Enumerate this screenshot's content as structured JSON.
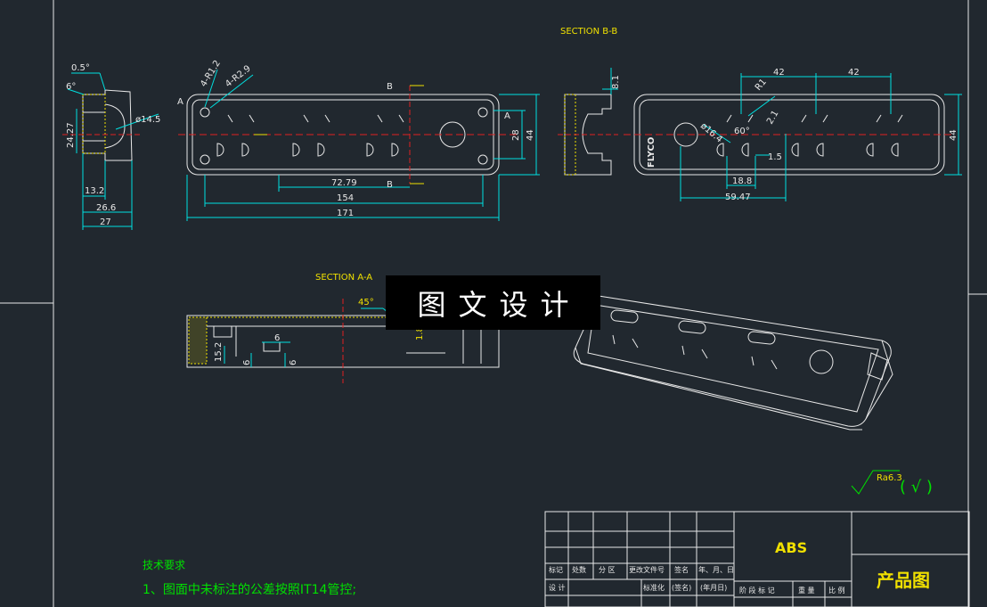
{
  "drawing": {
    "section_bb_label": "SECTION B-B",
    "section_aa_label": "SECTION A-A",
    "watermark": "图文设计",
    "material": "ABS",
    "product_name": "产品图",
    "roughness": "Ra6.3",
    "roughness_suffix": "( √ )",
    "tech_req_title": "技术要求",
    "tech_req_item1": "1、图面中未标注的公差按照IT14管控;",
    "side_view_dims": {
      "angle_05": "0.5°",
      "angle_6": "6°",
      "d_145": "ø14.5",
      "d_2427": "24.27",
      "d_132": "13.2",
      "d_266": "26.6",
      "d_27": "27"
    },
    "front_view_dims": {
      "r12": "4-R1.2",
      "r29": "4-R2.9",
      "b": "B",
      "a": "A",
      "d_7279": "72.79",
      "d_154": "154",
      "d_171": "171",
      "d_28": "28",
      "d_44": "44"
    },
    "section_view_dims": {
      "d_81": "8.1"
    },
    "top_view_dims": {
      "d_42a": "42",
      "d_42b": "42",
      "r1": "R1",
      "d_21": "2.1",
      "d_164": "ø16.4",
      "angle_60": "60°",
      "d_15": "1.5",
      "d_188": "18.8",
      "d_5947": "59.47",
      "d_44": "44",
      "brand": "FLYCO"
    },
    "sectionaa_dims": {
      "angle_45": "45°",
      "d_6a": "6",
      "d_152": "15.2",
      "d_6b": "6",
      "d_6c": "6",
      "d_18": "1.8"
    },
    "title_block": {
      "col_mark": "标记",
      "col_qty": "处数",
      "col_zone": "分 区",
      "col_docno": "更改文件号",
      "col_sign": "签名",
      "col_date": "年、月、日",
      "row_design": "设 计",
      "row_std": "标准化",
      "sign2": "(签名)",
      "date2": "(年月日)",
      "stage": "阶 段 标 记",
      "weight": "重 量",
      "scale": "比 例"
    }
  }
}
